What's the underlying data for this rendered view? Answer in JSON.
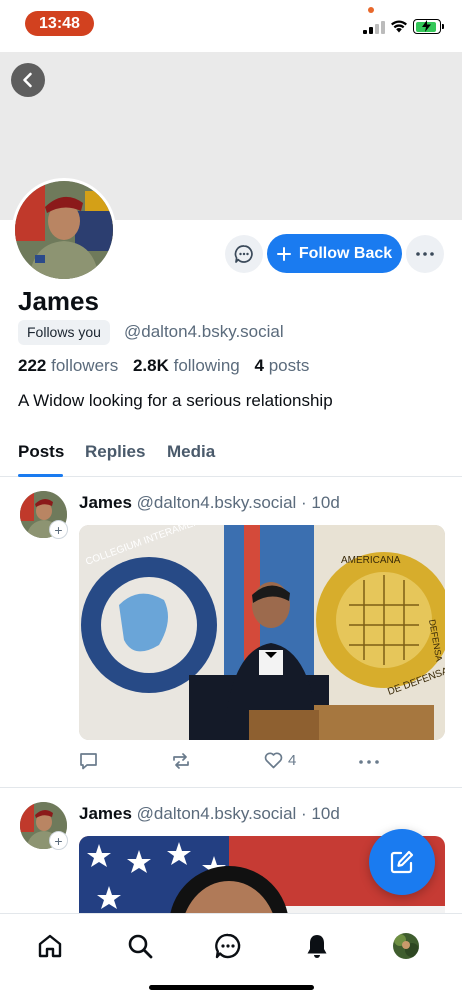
{
  "status_bar": {
    "time": "13:48"
  },
  "profile": {
    "name": "James",
    "follows_you_label": "Follows you",
    "handle": "@dalton4.bsky.social",
    "followers_count": "222",
    "followers_label": "followers",
    "following_count": "2.8K",
    "following_label": "following",
    "posts_count": "4",
    "posts_label": "posts",
    "bio": "A Widow looking for a serious relationship",
    "follow_back_label": "Follow Back"
  },
  "tabs": [
    {
      "label": "Posts",
      "active": true
    },
    {
      "label": "Replies",
      "active": false
    },
    {
      "label": "Media",
      "active": false
    }
  ],
  "posts": [
    {
      "author": "James",
      "handle": "@dalton4.bsky.social",
      "time": "· 10d",
      "likes": "4",
      "image_text_left": "COLLEGIUM INTERAMERICANUM DEFENSIONIS",
      "image_text_right_top": "AMERICANA",
      "image_text_right_mid": "DEFENSA",
      "image_text_right_bottom": "DE DEFENSA"
    },
    {
      "author": "James",
      "handle": "@dalton4.bsky.social",
      "time": "· 10d"
    }
  ],
  "nav": [
    "home-icon",
    "search-icon",
    "chat-icon",
    "bell-icon",
    "avatar"
  ],
  "colors": {
    "accent": "#1a7bf0",
    "muted_text": "#5b6b7c",
    "time_pill": "#d2411f"
  }
}
